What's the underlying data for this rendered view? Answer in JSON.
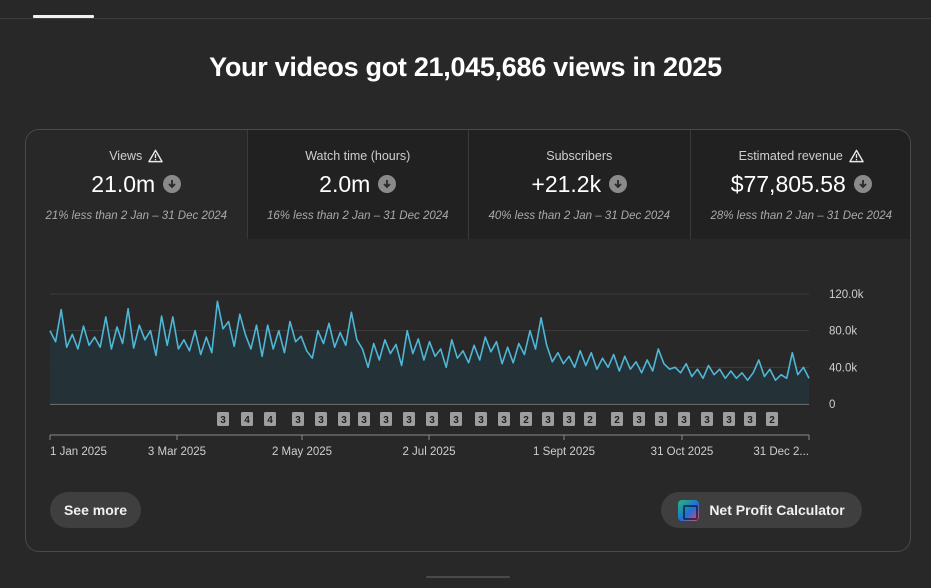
{
  "headline": "Your videos got 21,045,686 views in 2025",
  "metrics": [
    {
      "title": "Views",
      "warning": true,
      "value": "21.0m",
      "trend_icon": "arrow-down-icon",
      "compare": "21% less than 2 Jan – 31 Dec 2024"
    },
    {
      "title": "Watch time (hours)",
      "warning": false,
      "value": "2.0m",
      "trend_icon": "arrow-down-icon",
      "compare": "16% less than 2 Jan – 31 Dec 2024"
    },
    {
      "title": "Subscribers",
      "warning": false,
      "value": "+21.2k",
      "trend_icon": "arrow-down-icon",
      "compare": "40% less than 2 Jan – 31 Dec 2024"
    },
    {
      "title": "Estimated revenue",
      "warning": true,
      "value": "$77,805.58",
      "trend_icon": "arrow-down-icon",
      "compare": "28% less than 2 Jan – 31 Dec 2024"
    }
  ],
  "buttons": {
    "see_more": "See more",
    "net_profit": "Net Profit Calculator"
  },
  "colors": {
    "line": "#4fb6d6",
    "area": "#233238",
    "marker_bg": "#9e9e9e",
    "marker_text": "#1f1f1f"
  },
  "chart_data": {
    "type": "area",
    "x_labels": [
      "1 Jan 2025",
      "3 Mar 2025",
      "2 May 2025",
      "2 Jul 2025",
      "1 Sept 2025",
      "31 Oct 2025",
      "31 Dec 2..."
    ],
    "y_ticks": [
      "0",
      "40.0k",
      "80.0k",
      "120.0k"
    ],
    "ylim": [
      0,
      120000
    ],
    "series": [
      {
        "values": [
          80000,
          68000,
          103000,
          62000,
          76000,
          60000,
          85000,
          64000,
          73000,
          62000,
          95000,
          60000,
          84000,
          66000,
          104000,
          61000,
          86000,
          70000,
          80000,
          53000,
          96000,
          64000,
          95000,
          60000,
          70000,
          58000,
          80000,
          54000,
          73000,
          56000,
          112000,
          82000,
          90000,
          63000,
          98000,
          76000,
          60000,
          86000,
          52000,
          86000,
          60000,
          80000,
          56000,
          90000,
          68000,
          74000,
          58000,
          50000,
          80000,
          66000,
          88000,
          62000,
          78000,
          64000,
          100000,
          70000,
          60000,
          40000,
          66000,
          48000,
          70000,
          55000,
          65000,
          42000,
          80000,
          55000,
          71000,
          48000,
          68000,
          52000,
          60000,
          40000,
          70000,
          50000,
          58000,
          45000,
          64000,
          48000,
          73000,
          57000,
          68000,
          44000,
          62000,
          45000,
          66000,
          54000,
          80000,
          60000,
          94000,
          64000,
          46000,
          56000,
          44000,
          52000,
          40000,
          58000,
          42000,
          56000,
          38000,
          50000,
          40000,
          54000,
          36000,
          52000,
          38000,
          46000,
          34000,
          48000,
          36000,
          60000,
          44000,
          38000,
          40000,
          34000,
          44000,
          30000,
          38000,
          28000,
          42000,
          32000,
          38000,
          28000,
          36000,
          28000,
          34000,
          26000,
          34000,
          48000,
          30000,
          38000,
          26000,
          32000,
          28000,
          56000,
          32000,
          40000,
          28000
        ]
      }
    ],
    "markers": [
      "3",
      "4",
      "4",
      "3",
      "3",
      "3",
      "3",
      "3",
      "3",
      "3",
      "3",
      "3",
      "3",
      "2",
      "3",
      "3",
      "2",
      "2",
      "3",
      "3",
      "3",
      "3",
      "3",
      "3",
      "2"
    ]
  }
}
